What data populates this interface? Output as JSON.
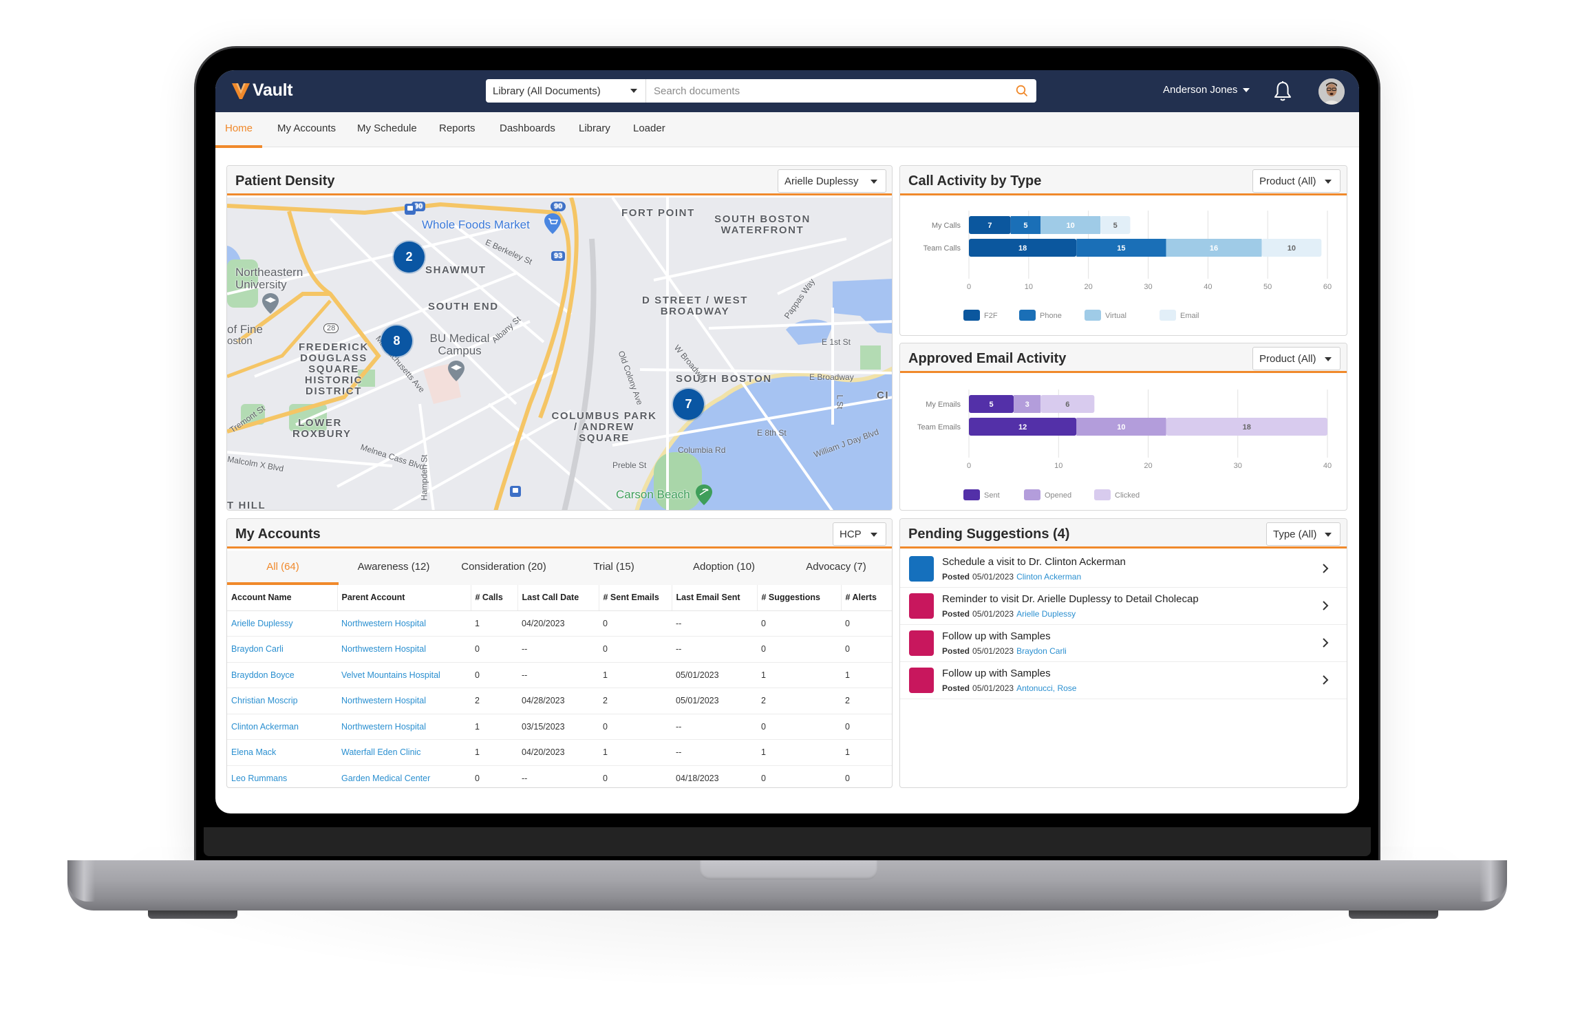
{
  "header": {
    "app_name": "Vault",
    "search_scope": "Library (All Documents)",
    "search_placeholder": "Search documents",
    "search_value": "",
    "user_name": "Anderson Jones",
    "icons": {
      "logo": "vault-v-logo",
      "search": "search-icon",
      "bell": "bell-icon",
      "avatar": "user-avatar"
    }
  },
  "nav": {
    "active": "Home",
    "tabs": [
      "Home",
      "My Accounts",
      "My Schedule",
      "Reports",
      "Dashboards",
      "Library",
      "Loader"
    ]
  },
  "patient_density": {
    "title": "Patient Density",
    "filter": "Arielle Duplessy",
    "clusters": [
      {
        "label": "2",
        "area": "Shawmut"
      },
      {
        "label": "8",
        "area": "Frederick Douglass Square"
      },
      {
        "label": "7",
        "area": "South Boston"
      }
    ],
    "neighborhoods": [
      "FORT POINT",
      "SOUTH BOSTON WATERFRONT",
      "SHAWMUT",
      "SOUTH END",
      "D STREET / WEST BROADWAY",
      "FREDERICK DOUGLASS SQUARE HISTORIC DISTRICT",
      "LOWER ROXBURY",
      "COLUMBUS PARK / ANDREW SQUARE",
      "SOUTH BOSTON",
      "T HILL",
      "CI"
    ],
    "streets": [
      "E Berkeley St",
      "Albany St",
      "Massachusetts Ave",
      "Tremont St",
      "Malcolm X Blvd",
      "Melnea Cass Blvd",
      "Hampden St",
      "Old Colony Ave",
      "W Broadway",
      "Pappas Way",
      "E 1st St",
      "E Broadway",
      "L St",
      "E 8th St",
      "Columbia Rd",
      "Preble St",
      "William J Day Blvd"
    ],
    "places": [
      "Whole Foods Market",
      "Northeastern University",
      "BU Medical Campus",
      "Carson Beach",
      "of Fine",
      "oston"
    ],
    "highway_shields": [
      "90",
      "93",
      "28"
    ]
  },
  "call_activity": {
    "title": "Call Activity by Type",
    "filter": "Product (All)"
  },
  "email_activity": {
    "title": "Approved Email Activity",
    "filter": "Product (All)"
  },
  "chart_data": [
    {
      "type": "bar",
      "orientation": "horizontal",
      "stacked": true,
      "title": "Call Activity by Type",
      "categories": [
        "My Calls",
        "Team Calls"
      ],
      "series": [
        {
          "name": "F2F",
          "values": [
            7,
            18
          ],
          "color": "#0b579e"
        },
        {
          "name": "Phone",
          "values": [
            5,
            15
          ],
          "color": "#1a6fb7"
        },
        {
          "name": "Virtual",
          "values": [
            10,
            16
          ],
          "color": "#9fcbe7"
        },
        {
          "name": "Email",
          "values": [
            5,
            10
          ],
          "color": "#e2eff8"
        }
      ],
      "xlim": [
        0,
        60
      ],
      "xticks": [
        0,
        10,
        20,
        30,
        40,
        50,
        60
      ],
      "grid": true,
      "legend": "bottom",
      "data_labels": true
    },
    {
      "type": "bar",
      "orientation": "horizontal",
      "stacked": true,
      "title": "Approved Email Activity",
      "categories": [
        "My Emails",
        "Team Emails"
      ],
      "series": [
        {
          "name": "Sent",
          "values": [
            5,
            12
          ],
          "color": "#5330a8"
        },
        {
          "name": "Opened",
          "values": [
            3,
            10
          ],
          "color": "#b39ddb"
        },
        {
          "name": "Clicked",
          "values": [
            6,
            18
          ],
          "color": "#d8cbee"
        }
      ],
      "xlim": [
        0,
        40
      ],
      "xticks": [
        0,
        10,
        20,
        30,
        40
      ],
      "grid": true,
      "legend": "bottom",
      "data_labels": true
    }
  ],
  "accounts": {
    "title": "My Accounts",
    "filter": "HCP",
    "tabs": [
      {
        "label": "All (64)",
        "active": true
      },
      {
        "label": "Awareness (12)",
        "active": false
      },
      {
        "label": "Consideration (20)",
        "active": false
      },
      {
        "label": "Trial (15)",
        "active": false
      },
      {
        "label": "Adoption (10)",
        "active": false
      },
      {
        "label": "Advocacy (7)",
        "active": false
      }
    ],
    "columns": [
      "Account Name",
      "Parent Account",
      "# Calls",
      "Last Call Date",
      "# Sent Emails",
      "Last Email Sent",
      "# Suggestions",
      "# Alerts"
    ],
    "rows": [
      [
        "Arielle Duplessy",
        "Northwestern Hospital",
        "1",
        "04/20/2023",
        "0",
        "--",
        "0",
        "0"
      ],
      [
        "Braydon Carli",
        "Northwestern Hospital",
        "0",
        "--",
        "0",
        "--",
        "0",
        "0"
      ],
      [
        "Brayddon Boyce",
        "Velvet Mountains Hospital",
        "0",
        "--",
        "1",
        "05/01/2023",
        "1",
        "1"
      ],
      [
        "Christian Moscrip",
        "Northwestern Hospital",
        "2",
        "04/28/2023",
        "2",
        "05/01/2023",
        "2",
        "2"
      ],
      [
        "Clinton Ackerman",
        "Northwestern Hospital",
        "1",
        "03/15/2023",
        "0",
        "--",
        "0",
        "0"
      ],
      [
        "Elena Mack",
        "Waterfall Eden Clinic",
        "1",
        "04/20/2023",
        "1",
        "--",
        "1",
        "1"
      ],
      [
        "Leo Rummans",
        "Garden Medical Center",
        "0",
        "--",
        "0",
        "04/18/2023",
        "0",
        "0"
      ]
    ]
  },
  "suggestions": {
    "title": "Pending Suggestions (4)",
    "filter": "Type (All)",
    "posted_label": "Posted",
    "items": [
      {
        "title": "Schedule a visit to Dr. Clinton Ackerman",
        "date": "05/01/2023",
        "account": "Clinton Ackerman",
        "color": "#1570bd"
      },
      {
        "title": "Reminder to visit Dr. Arielle Duplessy to Detail Cholecap",
        "date": "05/01/2023",
        "account": "Arielle Duplessy",
        "color": "#c8175d"
      },
      {
        "title": "Follow up with Samples",
        "date": "05/01/2023",
        "account": "Braydon Carli",
        "color": "#c8175d"
      },
      {
        "title": "Follow up with Samples",
        "date": "05/01/2023",
        "account": "Antonucci, Rose",
        "color": "#c8175d"
      }
    ]
  }
}
